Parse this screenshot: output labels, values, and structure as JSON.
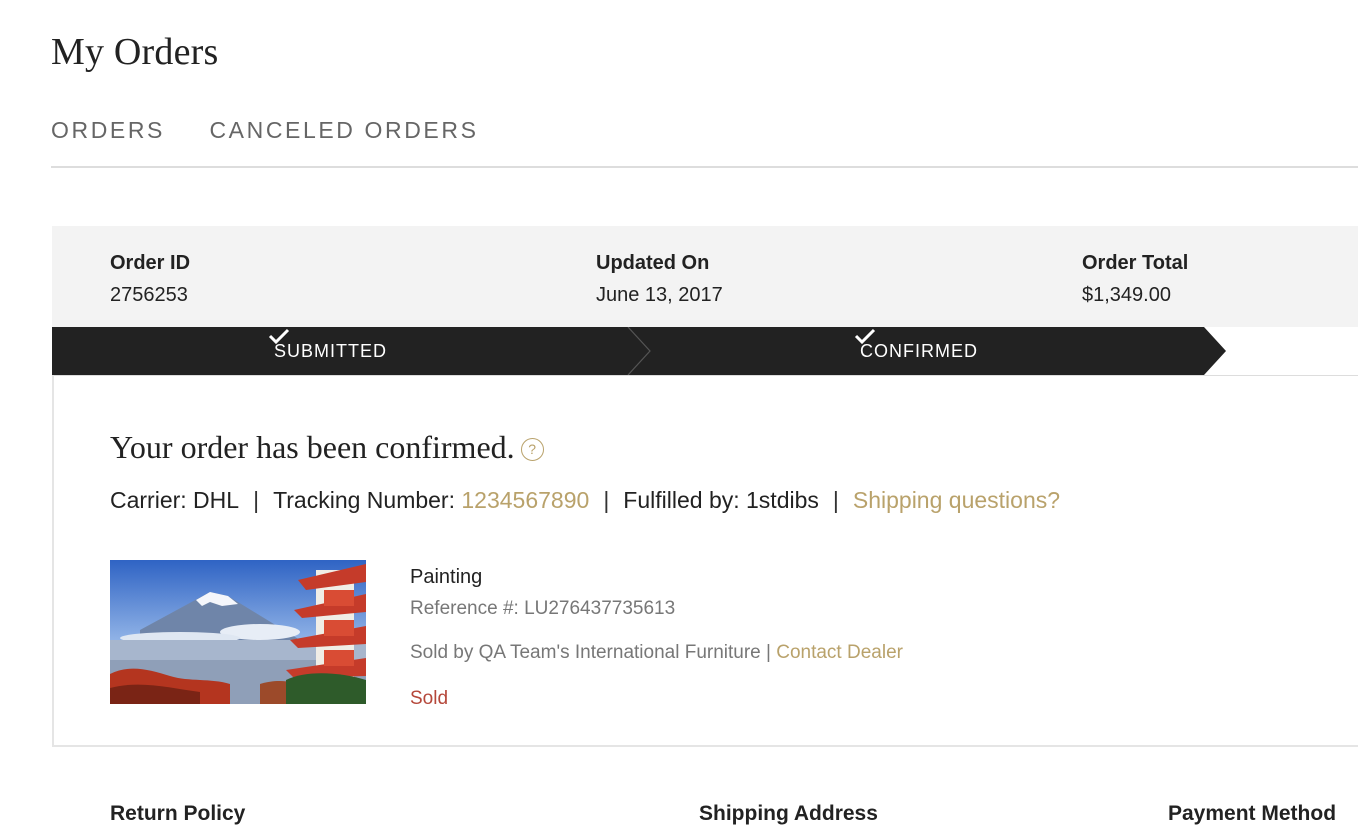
{
  "page": {
    "title": "My Orders"
  },
  "tabs": [
    {
      "label": "ORDERS"
    },
    {
      "label": "CANCELED ORDERS"
    }
  ],
  "order": {
    "id_label": "Order ID",
    "id_value": "2756253",
    "updated_label": "Updated On",
    "updated_value": "June 13, 2017",
    "total_label": "Order Total",
    "total_value": "$1,349.00"
  },
  "progress": {
    "steps": [
      {
        "label": "SUBMITTED",
        "done": true
      },
      {
        "label": "CONFIRMED",
        "done": true
      }
    ]
  },
  "confirmation": {
    "title": "Your order has been confirmed.",
    "help_glyph": "?",
    "carrier": "Carrier: DHL",
    "tracking_label": "Tracking Number:",
    "tracking_number": "1234567890",
    "fulfilled": "Fulfilled by: 1stdibs",
    "shipping_questions": "Shipping questions?",
    "separator": "|"
  },
  "item": {
    "title": "Painting",
    "reference": "Reference #: LU276437735613",
    "sold_by": "Sold by QA Team's International Furniture | ",
    "contact_dealer": "Contact Dealer",
    "status": "Sold",
    "image_icon": "mountain-pagoda-photo"
  },
  "footer": {
    "return_policy": "Return Policy",
    "shipping_address": "Shipping Address",
    "payment_method": "Payment Method"
  },
  "colors": {
    "accent_gold": "#b9a26b",
    "progress_bg": "#222222",
    "status_sold": "#b5473a",
    "summary_bg": "#f3f3f3"
  }
}
